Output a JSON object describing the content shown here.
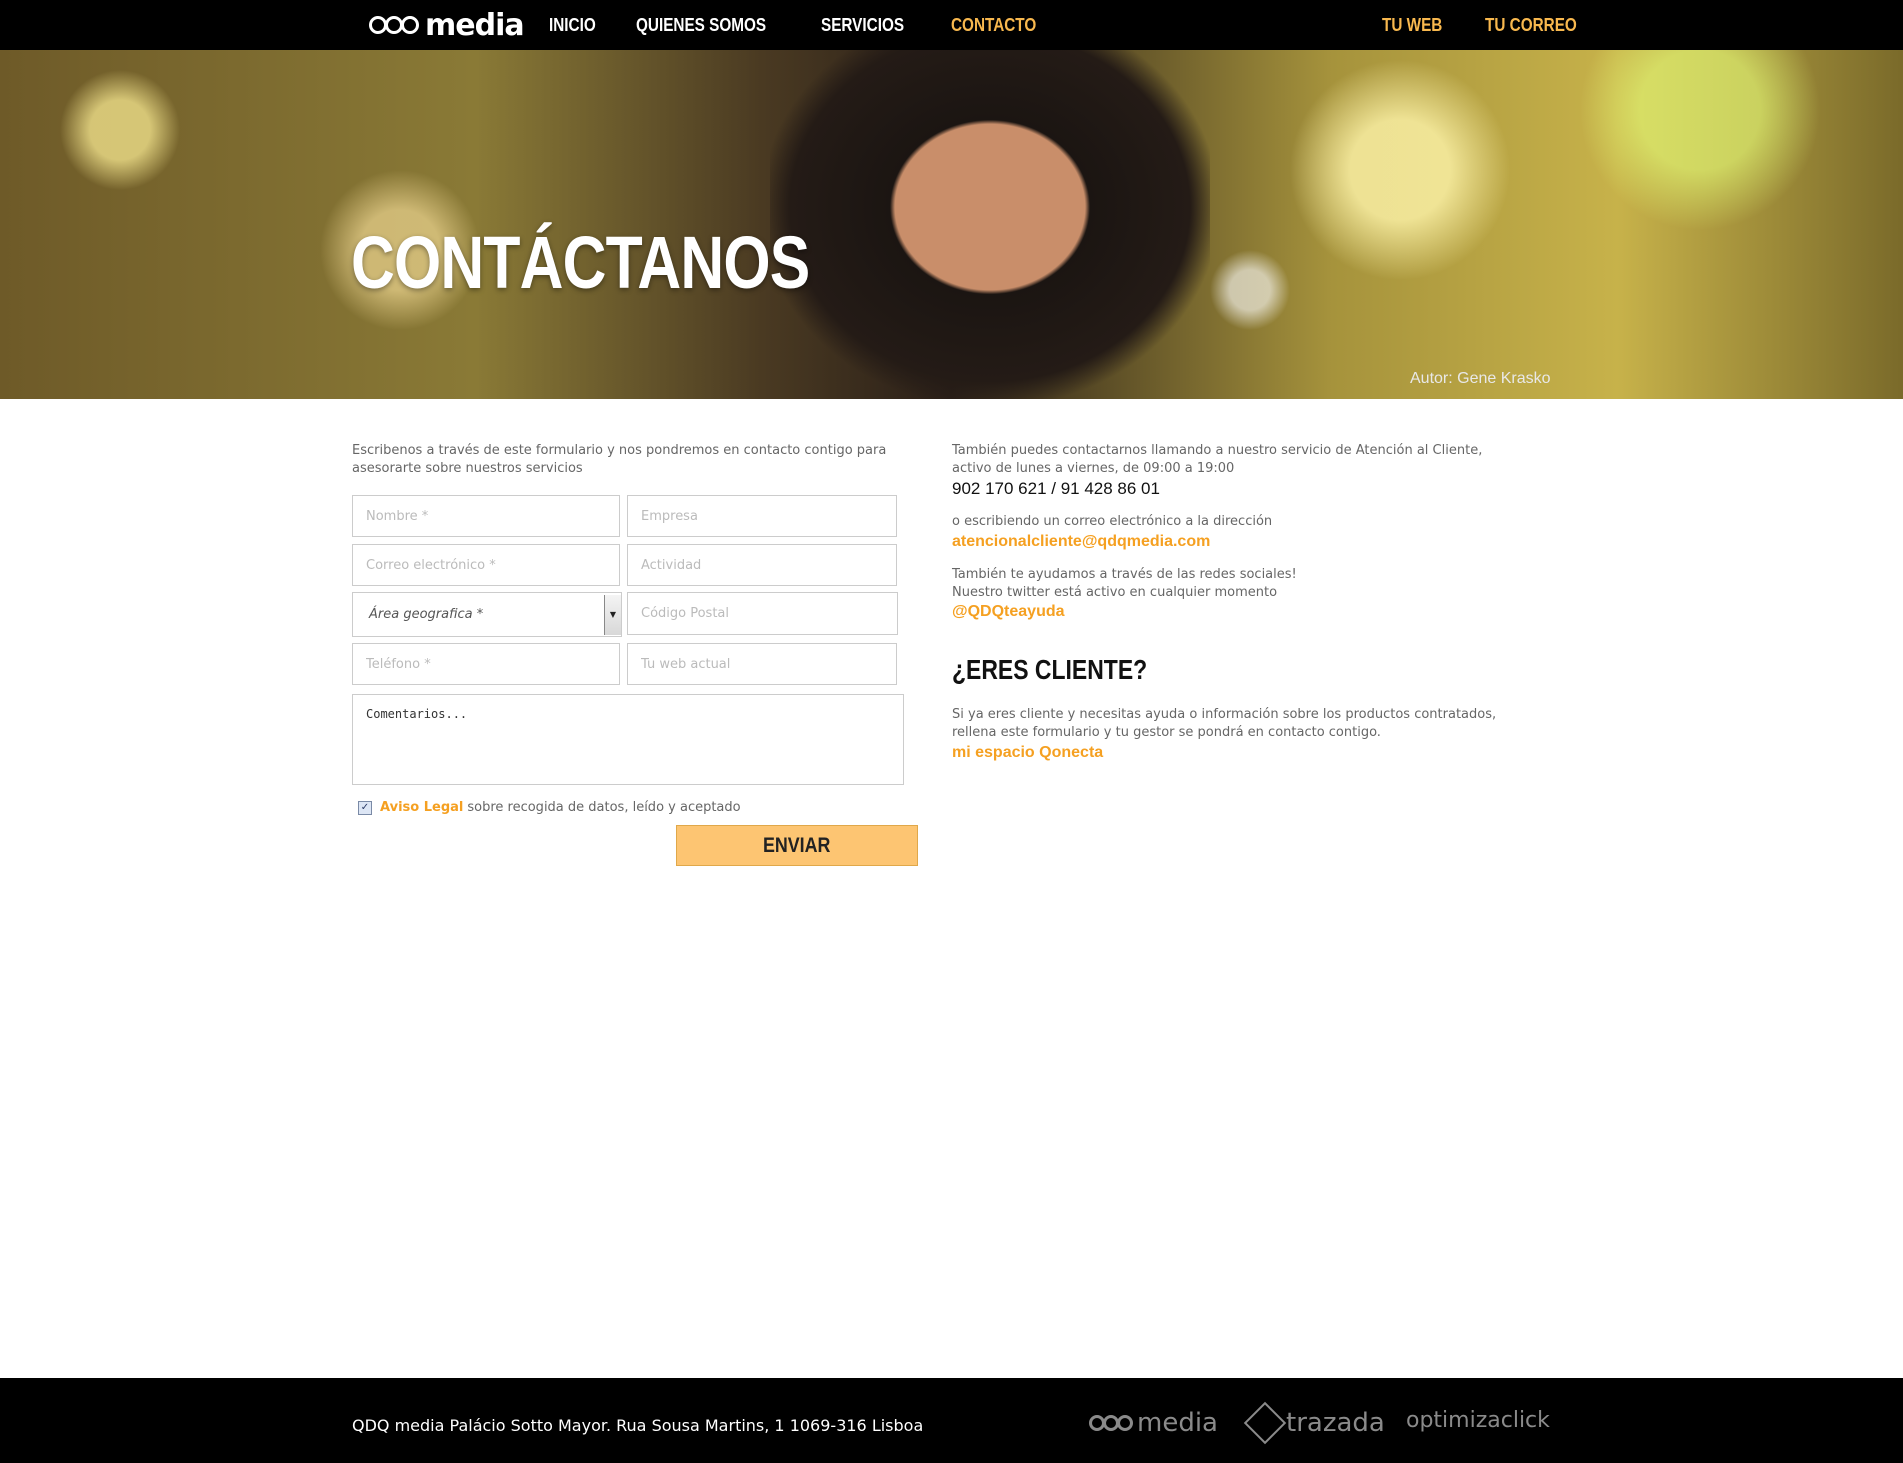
{
  "nav": {
    "logo_text": "media",
    "left_items": [
      "INICIO",
      "QUIENES SOMOS",
      "SERVICIOS",
      "CONTACTO"
    ],
    "active_item": "CONTACTO",
    "right_items": [
      "TU WEB",
      "TU CORREO"
    ]
  },
  "hero": {
    "title": "CONTÁCTANOS",
    "credit": "Autor: Gene Krasko"
  },
  "form": {
    "intro": "Escribenos a través de este formulario y nos pondremos en contacto contigo para asesorarte sobre nuestros servicios",
    "placeholders": {
      "nombre": "Nombre *",
      "empresa": "Empresa",
      "correo": "Correo electrónico *",
      "actividad": "Actividad",
      "codigo_postal": "Código Postal",
      "telefono": "Teléfono *",
      "web": "Tu web actual"
    },
    "area_select_value": "Área geografica *",
    "comments_value": "Comentarios...",
    "legal_checked": true,
    "legal_link": "Aviso Legal",
    "legal_text": "sobre recogida de datos, leído y aceptado",
    "submit_label": "ENVIAR"
  },
  "contact": {
    "phone_intro": "También puedes contactarnos llamando a nuestro servicio de Atención al Cliente, activo de lunes a viernes, de 09:00 a 19:00",
    "phone": "902 170 621 / 91 428 86 01",
    "email_intro": "o escribiendo un correo electrónico a la dirección",
    "email": "atencionalcliente@qdqmedia.com",
    "social_intro_1": "También te ayudamos a través de las redes sociales!",
    "social_intro_2": "Nuestro twitter está activo en cualquier momento",
    "twitter": "@QDQteayuda",
    "client_heading": "¿ERES CLIENTE?",
    "client_text": "Si ya eres cliente y necesitas ayuda o información sobre los productos contratados, rellena este formulario y tu gestor se pondrá en contacto contigo.",
    "client_link": "mi espacio Qonecta"
  },
  "footer": {
    "address": "QDQ media Palácio Sotto Mayor. Rua Sousa Martins, 1 1069-316 Lisboa",
    "logos": [
      "media",
      "trazada",
      "optimizaclick"
    ]
  },
  "colors": {
    "accent": "#f5a021",
    "button": "#fdc572",
    "nav_bg": "#000000"
  }
}
